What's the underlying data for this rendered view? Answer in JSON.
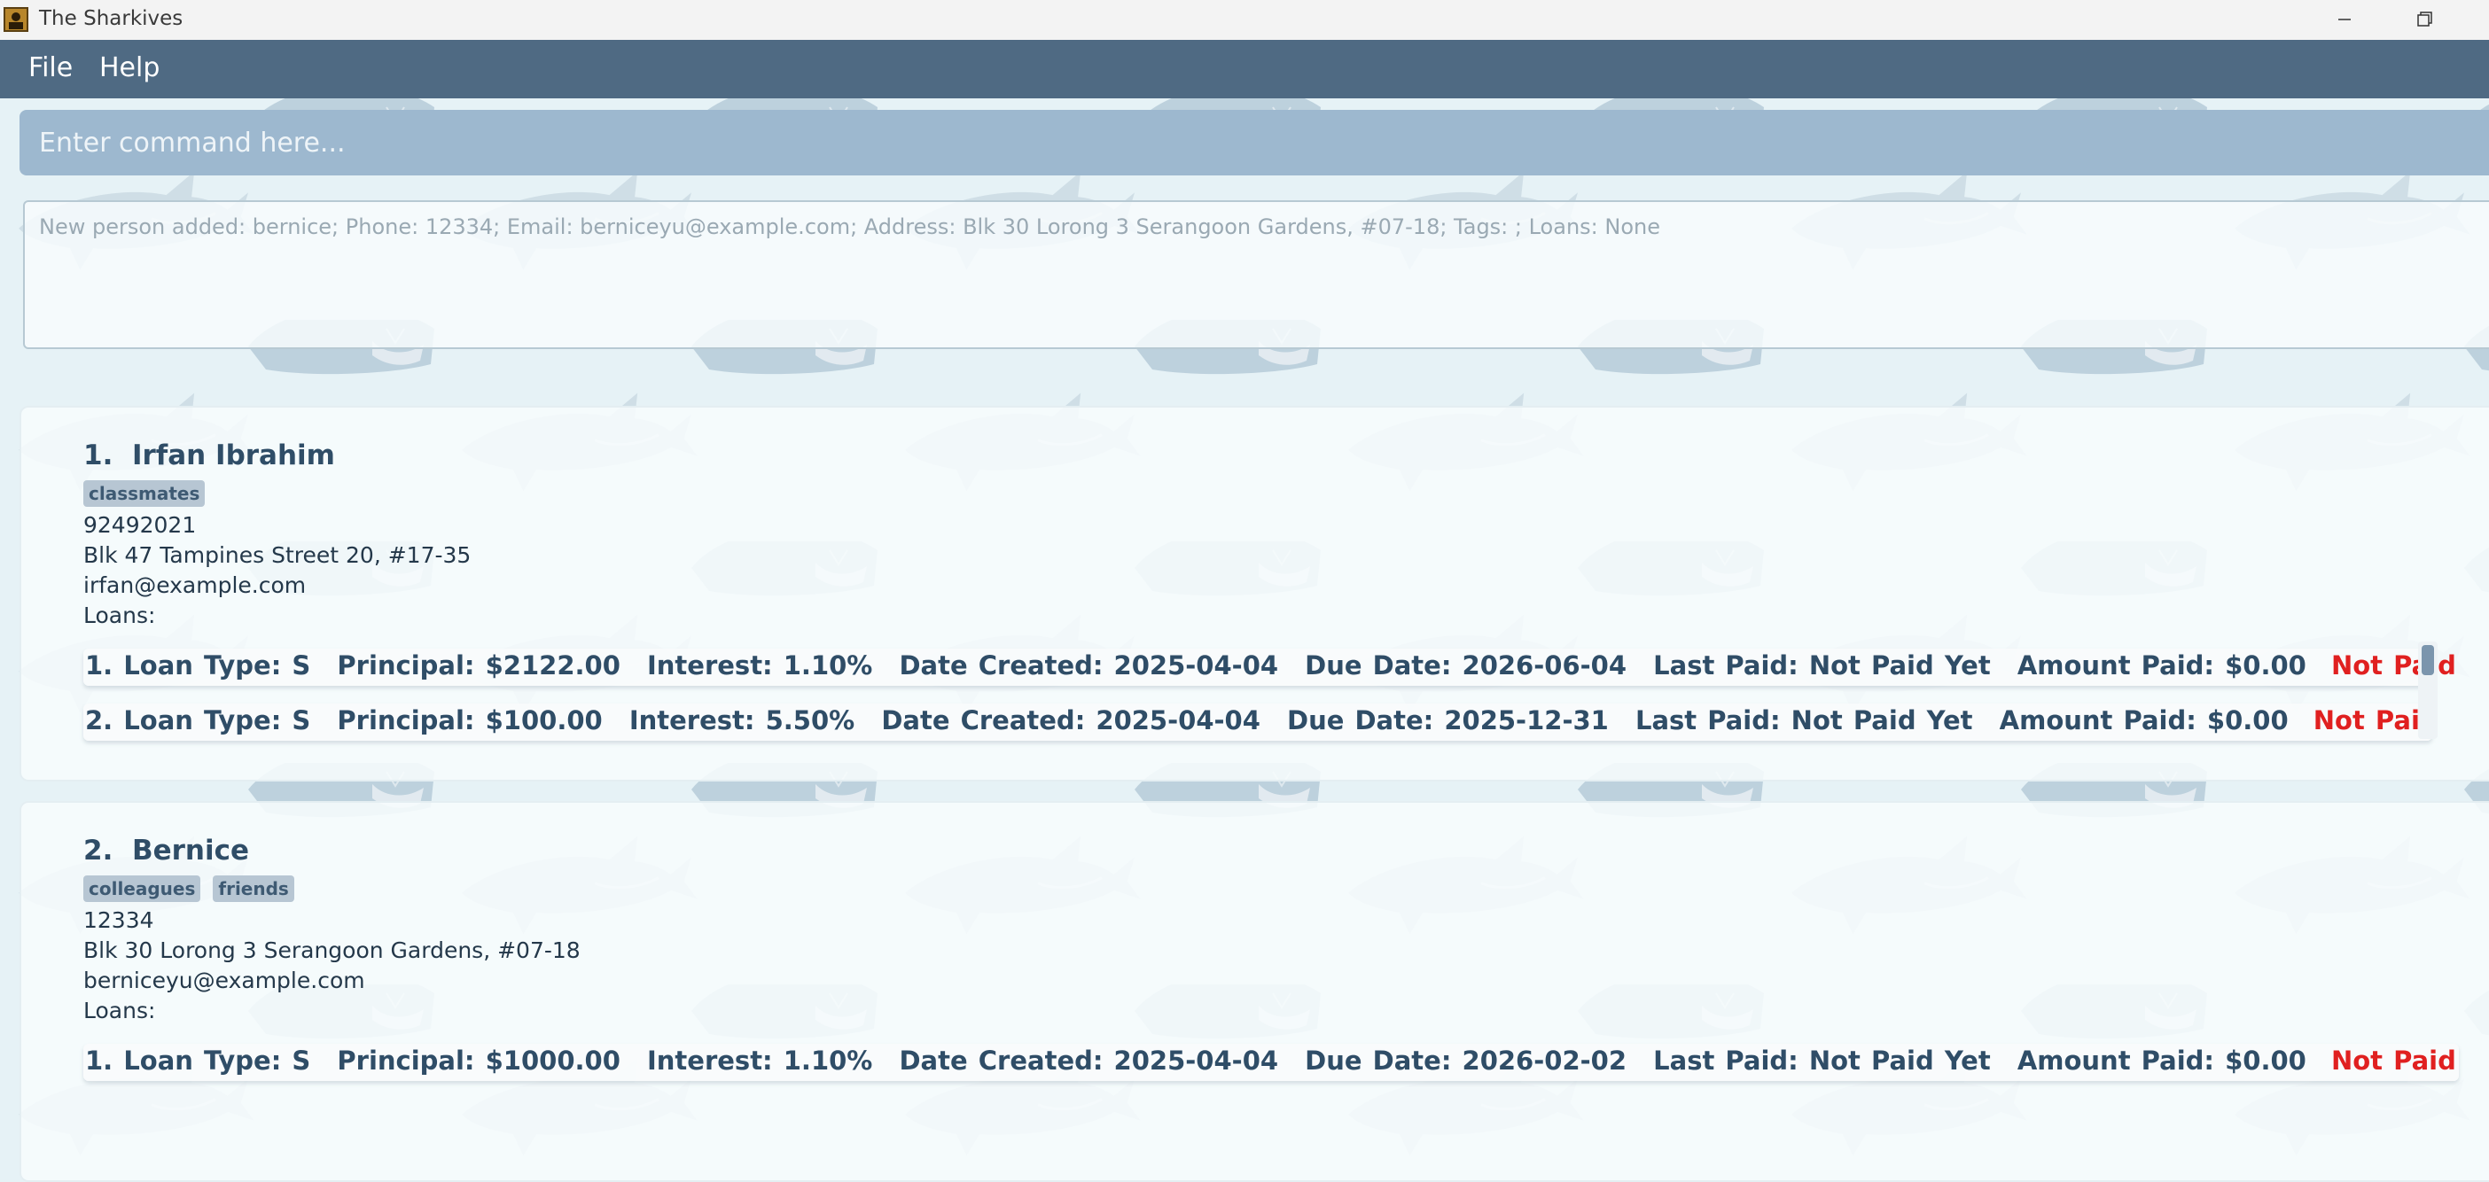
{
  "window": {
    "title": "The Sharkives"
  },
  "menu": {
    "file": "File",
    "help": "Help"
  },
  "command": {
    "placeholder": "Enter command here..."
  },
  "result": {
    "text": "New person added: bernice; Phone: 12334; Email: berniceyu@example.com; Address: Blk 30 Lorong 3 Serangoon Gardens, #07-18; Tags: ; Loans: None"
  },
  "persons": [
    {
      "index": "1.",
      "name": "Irfan Ibrahim",
      "tags": [
        "classmates"
      ],
      "phone": "92492021",
      "address": "Blk 47 Tampines Street 20, #17-35",
      "email": "irfan@example.com",
      "loans_label": "Loans:",
      "loans": [
        {
          "num": "1.",
          "type": "Loan Type: S",
          "principal": "Principal: $2122.00",
          "interest": "Interest: 1.10%",
          "created": "Date Created: 2025-04-04",
          "due": "Due Date: 2026-06-04",
          "last_paid": "Last Paid: Not Paid Yet",
          "amount_paid": "Amount Paid: $0.00",
          "status": "Not Paid"
        },
        {
          "num": "2.",
          "type": "Loan Type: S",
          "principal": "Principal: $100.00",
          "interest": "Interest: 5.50%",
          "created": "Date Created: 2025-04-04",
          "due": "Due Date: 2025-12-31",
          "last_paid": "Last Paid: Not Paid Yet",
          "amount_paid": "Amount Paid: $0.00",
          "status": "Not Paid"
        }
      ]
    },
    {
      "index": "2.",
      "name": "Bernice",
      "tags": [
        "colleagues",
        "friends"
      ],
      "phone": "12334",
      "address": "Blk 30 Lorong 3 Serangoon Gardens, #07-18",
      "email": "berniceyu@example.com",
      "loans_label": "Loans:",
      "loans": [
        {
          "num": "1.",
          "type": "Loan Type: S",
          "principal": "Principal: $1000.00",
          "interest": "Interest: 1.10%",
          "created": "Date Created: 2025-04-04",
          "due": "Due Date: 2026-02-02",
          "last_paid": "Last Paid: Not Paid Yet",
          "amount_paid": "Amount Paid: $0.00",
          "status": "Not Paid"
        }
      ]
    }
  ],
  "colors": {
    "menubar": "#4f6a83",
    "command_bg": "#9db8cf",
    "name_text": "#2f4d67",
    "not_paid": "#e02020",
    "tag_bg": "#b7c6d3"
  },
  "icons": {
    "app": "app-icon",
    "minimize": "minimize-icon",
    "maximize": "maximize-icon",
    "shark": "shark-watermark"
  }
}
